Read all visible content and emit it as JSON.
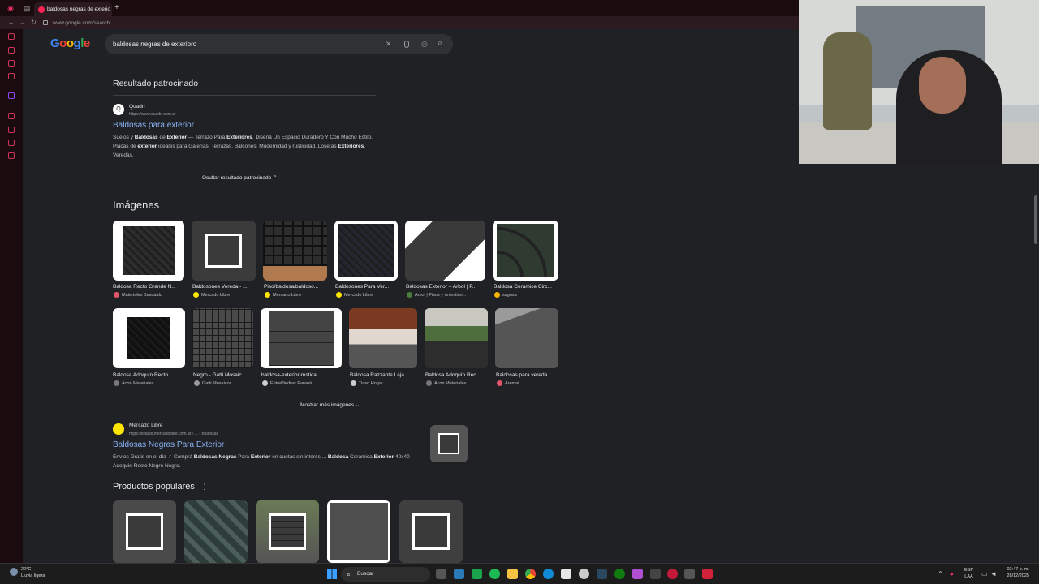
{
  "browser": {
    "tab_title": "baldosas negras de exterio",
    "new_tab": "+",
    "url": "www.google.com/search",
    "back": "←",
    "forward": "→",
    "reload": "↻"
  },
  "google": {
    "logo": [
      "G",
      "o",
      "o",
      "g",
      "l",
      "e"
    ],
    "query": "baldosas negras de exterioro",
    "clear_icon": "✕",
    "mic_icon": "🎙",
    "lens_icon": "◎",
    "search_icon": "⌕"
  },
  "sponsored": {
    "heading": "Resultado patrocinado",
    "favicon": "Q",
    "site": "Quadri",
    "url": "https://www.quadri.com.ar",
    "title": "Baldosas para exterior",
    "desc_1": "Suelos y ",
    "desc_b1": "Baldosas",
    "desc_2": " de ",
    "desc_b2": "Exterior",
    "desc_3": " — Terrazo Para ",
    "desc_b3": "Exteriores",
    "desc_4": ". Diseñá Un Espacio Duradero Y Con Mucho Estilo. Placas de ",
    "desc_b4": "exterior",
    "desc_5": " ideales para Galerías, Terrazas, Balcones. Modernidad y rusticidad. Losetas ",
    "desc_b5": "Exteriores",
    "desc_6": ". Veredas.",
    "hide": "Ocultar resultado patrocinado  ⌃"
  },
  "images": {
    "heading": "Imágenes",
    "row1": [
      {
        "caption": "Baldosa Recto Grande N...",
        "source": "Materiales Basualdo",
        "color": "#e4546b"
      },
      {
        "caption": "Baldosones Vereda - ...",
        "source": "Mercado Libre",
        "color": "#fee600"
      },
      {
        "caption": "Piso/baldosa/baldoso...",
        "source": "Mercado Libre",
        "color": "#fee600"
      },
      {
        "caption": "Baldosones Para Ver...",
        "source": "Mercado Libre",
        "color": "#fee600"
      },
      {
        "caption": "Baldosas Exterior – Arbol | P...",
        "source": "Arbol | Pisos y revestimi...",
        "color": "#4a7d3c"
      },
      {
        "caption": "Baldosa Ceramice Circ...",
        "source": "sagosa",
        "color": "#f4b400"
      }
    ],
    "row2": [
      {
        "caption": "Baldosa Adoquín Recto ...",
        "source": "Acon Materiales",
        "color": "#777777"
      },
      {
        "caption": "Negro - Gatti Mosaic...",
        "source": "Gatti Mosaicos ...",
        "color": "#999999"
      },
      {
        "caption": "baldosa-exterior-rustica",
        "source": "EntrePiedras Paraná",
        "color": "#cccccc"
      },
      {
        "caption": "Baldosa Razzante Laja ...",
        "source": "Tioso Hogar",
        "color": "#cccccc"
      },
      {
        "caption": "Baldosa Adoquín Rec...",
        "source": "Acon Materiales",
        "color": "#777777"
      },
      {
        "caption": "Baldosas para vereda...",
        "source": "Aremat",
        "color": "#e4546b"
      }
    ],
    "more": "Mostrar más imágenes  ⌄"
  },
  "result": {
    "site": "Mercado Libre",
    "url": "https://listado.mercadolibre.com.ar › ... › Baldosas",
    "title": "Baldosas Negras Para Exterior",
    "d1": "Envíos Gratis en el día ✓ Comprá ",
    "b1": "Baldosas Negras",
    "d2": " Para ",
    "b2": "Exterior",
    "d3": " en cuotas sin interés ... ",
    "b3": "Baldosa",
    "d4": " Ceramica ",
    "b4": "Exterior",
    "d5": " 40x40 Adoquin Recto Negro Negro."
  },
  "popular": {
    "heading": "Productos populares",
    "menu": "⋮"
  },
  "taskbar": {
    "temp": "22°C",
    "weather": "Lluvia ligera",
    "search": "Buscar",
    "lang1": "ESP",
    "lang2": "LAA",
    "time": "02:47 p. m.",
    "date": "28/12/2025"
  }
}
